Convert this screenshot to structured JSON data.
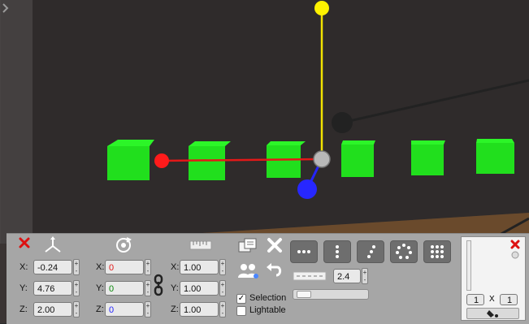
{
  "viewport": {
    "colors": {
      "floor": "#3b3533",
      "back_wall": "#2d2a2a",
      "left_wall": "#444040",
      "cube": "#22e21d",
      "axis_x": "#e31818",
      "axis_y": "#f1e200",
      "axis_z": "#2424ff"
    }
  },
  "panel": {
    "position": {
      "x_label": "X:",
      "y_label": "Y:",
      "z_label": "Z:",
      "x_value": "-0.24",
      "y_value": "4.76",
      "z_value": "2.00"
    },
    "rotation": {
      "x_label": "X:",
      "y_label": "Y:",
      "z_label": "Z:",
      "x_value": "0",
      "y_value": "0",
      "z_value": "0"
    },
    "scale": {
      "x_label": "X:",
      "y_label": "Y:",
      "z_label": "Z:",
      "x_value": "1.00",
      "y_value": "1.00",
      "z_value": "1.00"
    },
    "snap_value": "2.4",
    "selection_label": "Selection",
    "lightable_label": "Lightable",
    "tile_x": "1",
    "tile_y": "1",
    "tile_separator": "X"
  }
}
